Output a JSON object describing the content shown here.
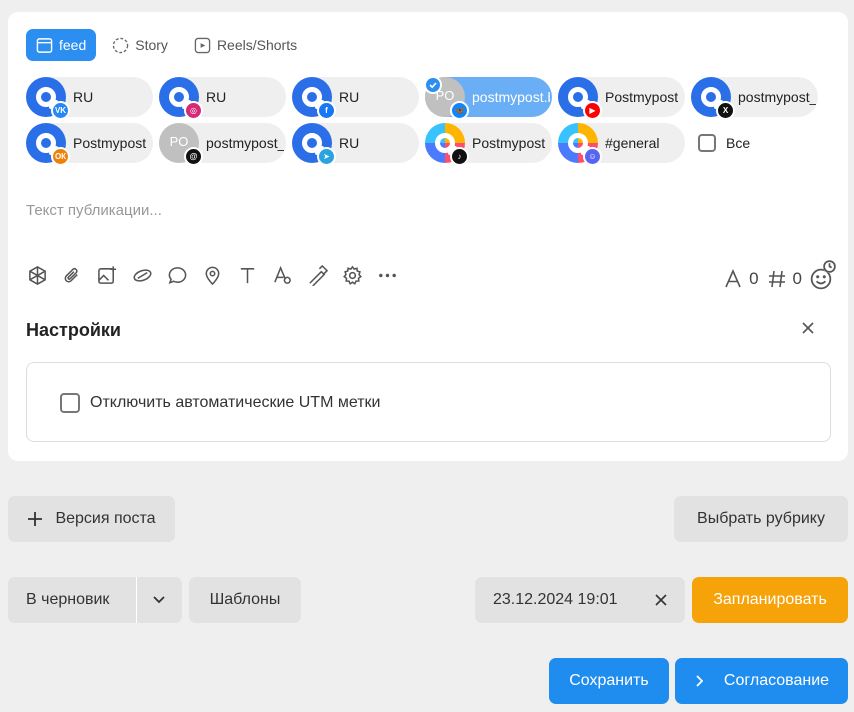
{
  "tabs": [
    {
      "label": "feed",
      "icon": "feed-icon"
    },
    {
      "label": "Story",
      "icon": "story-icon"
    },
    {
      "label": "Reels/Shorts",
      "icon": "reels-icon"
    }
  ],
  "accounts": [
    {
      "label": "RU",
      "avatar_text": "",
      "network": "VK",
      "badge_color": "#2787f5"
    },
    {
      "label": "RU",
      "avatar_text": "",
      "network": "Instagram",
      "badge_color": "#d62976"
    },
    {
      "label": "RU",
      "avatar_text": "",
      "network": "Facebook",
      "badge_color": "#1877f2"
    },
    {
      "label": "postmypost.bsk...",
      "avatar_text": "PO",
      "network": "Bluesky",
      "badge_color": "#1185fe",
      "selected": true
    },
    {
      "label": "Postmypost",
      "avatar_text": "",
      "network": "YouTube",
      "badge_color": "#ff0000"
    },
    {
      "label": "postmypost_ru",
      "avatar_text": "",
      "network": "X",
      "badge_color": "#111111"
    },
    {
      "label": "Postmypost",
      "avatar_text": "",
      "network": "Odnoklassniki",
      "badge_color": "#ee8208"
    },
    {
      "label": "postmypost_rus...",
      "avatar_text": "PO",
      "network": "Threads",
      "badge_color": "#111111"
    },
    {
      "label": "RU",
      "avatar_text": "",
      "network": "Telegram",
      "badge_color": "#2aa3e0"
    },
    {
      "label": "Postmypost",
      "avatar_text": "",
      "network": "TikTok",
      "badge_color": "#111111"
    },
    {
      "label": "#general",
      "avatar_text": "",
      "network": "Discord",
      "badge_color": "#5865f2"
    }
  ],
  "select_all_label": "Все",
  "editor": {
    "placeholder": "Текст публикации..."
  },
  "counters": {
    "chars": "0",
    "hashtags": "0"
  },
  "settings": {
    "title": "Настройки",
    "utm_label": "Отключить автоматические UTM метки"
  },
  "actions": {
    "version": "Версия поста",
    "rubric": "Выбрать рубрику",
    "draft": "В черновик",
    "templates": "Шаблоны",
    "datetime": "23.12.2024 19:01",
    "schedule": "Запланировать",
    "save": "Сохранить",
    "approval": "Согласование"
  },
  "colors": {
    "accent": "#2b8ef0",
    "orange": "#f6a30a",
    "selected_chip": "#6aaff6"
  }
}
